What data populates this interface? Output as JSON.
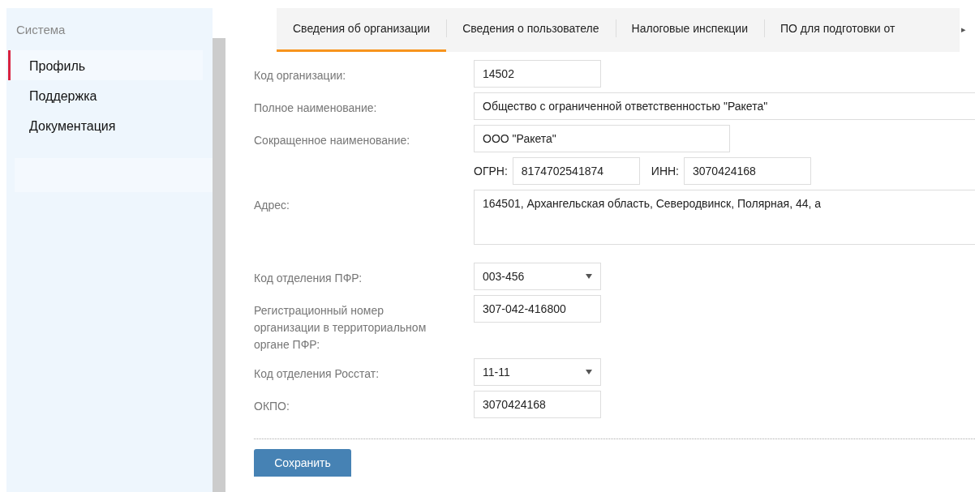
{
  "sidebar": {
    "title": "Система",
    "items": [
      {
        "label": "Профиль",
        "selected": true
      },
      {
        "label": "Поддержка",
        "selected": false
      },
      {
        "label": "Документация",
        "selected": false
      }
    ]
  },
  "tabs": [
    {
      "label": "Сведения об организации",
      "selected": true
    },
    {
      "label": "Сведения о пользователе",
      "selected": false
    },
    {
      "label": "Налоговые инспекции",
      "selected": false
    },
    {
      "label": "ПО для подготовки от",
      "selected": false
    }
  ],
  "tabs_more": "▸",
  "fields": [
    {
      "kind": "text",
      "label": "Код организации:",
      "value": "14502"
    },
    {
      "kind": "text",
      "label": "Полное наименование:",
      "value": "Общество с ограниченной ответственностью \"Ракета\""
    },
    {
      "kind": "text",
      "label": "Сокращенное наименование:",
      "value": "ООО \"Ракета\""
    },
    {
      "kind": "pair",
      "items": [
        {
          "label": "ОГРН:",
          "value": "8174702541874"
        },
        {
          "label": "ИНН:",
          "value": "3070424168"
        }
      ]
    },
    {
      "kind": "textarea",
      "label": "Адрес:",
      "value": "164501, Архангельская область, Северодвинск, Полярная, 44, а"
    },
    {
      "kind": "select",
      "label": "Код отделения ПФР:",
      "value": "003-456"
    },
    {
      "kind": "text",
      "label": "Регистрационный номер организации в территориальном органе ПФР:",
      "value": "307-042-416800"
    },
    {
      "kind": "select",
      "label": "Код отделения Росстат:",
      "value": "11-11"
    },
    {
      "kind": "text",
      "label": "ОКПО:",
      "value": "3070424168"
    }
  ],
  "save_button": "Сохранить"
}
